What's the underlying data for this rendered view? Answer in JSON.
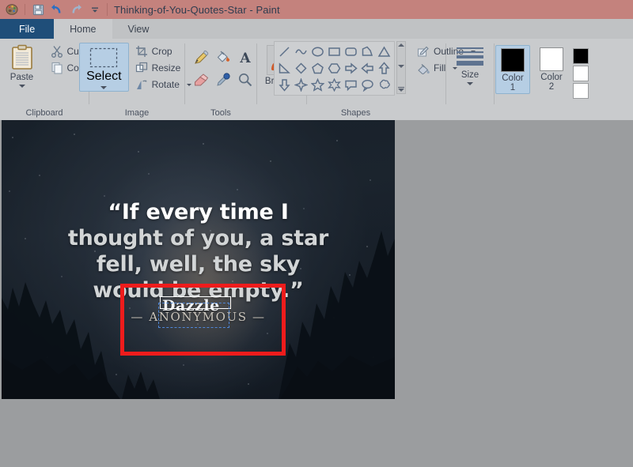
{
  "window": {
    "title": "Thinking-of-You-Quotes-Star - Paint",
    "quick_access": [
      {
        "name": "paint-logo-icon",
        "label": "Paint"
      },
      {
        "name": "save-icon",
        "label": "Save"
      },
      {
        "name": "undo-icon",
        "label": "Undo"
      },
      {
        "name": "redo-icon",
        "label": "Redo"
      },
      {
        "name": "customize-qat-icon",
        "label": "Customize Quick Access Toolbar"
      }
    ],
    "titlebar_color": "#c4827d"
  },
  "tabs": [
    {
      "label": "File",
      "id": "tab-file",
      "style": "file"
    },
    {
      "label": "Home",
      "id": "tab-home",
      "style": "active"
    },
    {
      "label": "View",
      "id": "tab-view",
      "style": "normal"
    }
  ],
  "ribbon": {
    "clipboard": {
      "label": "Clipboard",
      "paste": "Paste",
      "cut": "Cut",
      "copy": "Copy"
    },
    "image": {
      "label": "Image",
      "select": "Select",
      "crop": "Crop",
      "resize": "Resize",
      "rotate": "Rotate"
    },
    "tools": {
      "label": "Tools",
      "items": [
        {
          "name": "pencil-icon",
          "label": "Pencil"
        },
        {
          "name": "fill-bucket-icon",
          "label": "Fill with color"
        },
        {
          "name": "text-icon",
          "label": "Text"
        },
        {
          "name": "eraser-icon",
          "label": "Eraser"
        },
        {
          "name": "color-picker-icon",
          "label": "Color picker"
        },
        {
          "name": "magnifier-icon",
          "label": "Magnifier"
        }
      ]
    },
    "brushes": {
      "label": "Brushes"
    },
    "shapes": {
      "label": "Shapes",
      "items": [
        "line",
        "curve",
        "oval",
        "rectangle",
        "rounded-rectangle",
        "polygon",
        "triangle",
        "right-triangle",
        "diamond",
        "pentagon",
        "hexagon",
        "right-arrow",
        "left-arrow",
        "up-arrow",
        "down-arrow",
        "four-point-star",
        "five-point-star",
        "six-point-star",
        "rounded-callout",
        "oval-callout",
        "cloud-callout"
      ],
      "outline": "Outline",
      "fill": "Fill"
    },
    "size": {
      "label": "Size"
    },
    "colors": {
      "color1_label": "Color",
      "color1_num": "1",
      "color2_label": "Color",
      "color2_num": "2",
      "color1_value": "#000000",
      "color2_value": "#ffffff",
      "palette": [
        "#000000",
        "#ffffff",
        "#ffffff"
      ]
    }
  },
  "canvas": {
    "quote_lines": [
      "“If every time I",
      "thought of you, a star",
      "fell, well, the sky",
      "would be empty.”"
    ],
    "attribution": "— ANONYMOUS —",
    "overlay_text": "Dazzle",
    "annotations": [
      {
        "name": "red-rectangle-annotation",
        "color": "#ee1c1c",
        "style": "solid"
      },
      {
        "name": "white-rectangle-annotation",
        "color": "#ffffff",
        "style": "solid"
      },
      {
        "name": "blue-dashed-selection",
        "color": "#4f86d6",
        "style": "dashed"
      }
    ]
  }
}
